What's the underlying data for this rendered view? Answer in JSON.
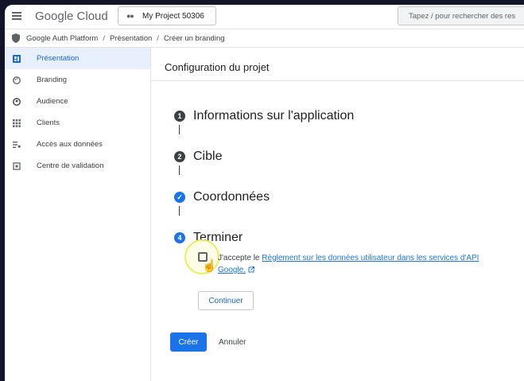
{
  "app": {
    "brand_google": "Google",
    "brand_cloud": " Cloud",
    "project_label": "My Project 50306",
    "search_placeholder": "Tapez / pour rechercher des res"
  },
  "breadcrumb": [
    "Google Auth Platform",
    "Présentation",
    "Créer un branding"
  ],
  "sidebar": {
    "items": [
      {
        "label": "Présentation",
        "icon": "dashboard-icon",
        "active": true
      },
      {
        "label": "Branding",
        "icon": "palette-icon",
        "active": false
      },
      {
        "label": "Audience",
        "icon": "person-icon",
        "active": false
      },
      {
        "label": "Clients",
        "icon": "grid-icon",
        "active": false
      },
      {
        "label": "Accès aux données",
        "icon": "data-access-icon",
        "active": false
      },
      {
        "label": "Centre de validation",
        "icon": "checkbox-frame-icon",
        "active": false
      }
    ]
  },
  "main": {
    "title": "Configuration du projet",
    "steps": [
      {
        "number": "1",
        "label": "Informations sur l'application",
        "state": "numbered"
      },
      {
        "number": "2",
        "label": "Cible",
        "state": "numbered"
      },
      {
        "number": "✓",
        "label": "Coordonnées",
        "state": "done"
      },
      {
        "number": "4",
        "label": "Terminer",
        "state": "current"
      }
    ],
    "consent": {
      "prefix": "J'accepte le ",
      "link": "Règlement sur les données utilisateur dans les services d'API Google."
    },
    "continue_label": "Continuer",
    "create_label": "Créer",
    "cancel_label": "Annuler"
  },
  "colors": {
    "accent": "#1a73e8",
    "active_bg": "#e8f0fe",
    "cursor_highlight": "#e8ef5c"
  }
}
